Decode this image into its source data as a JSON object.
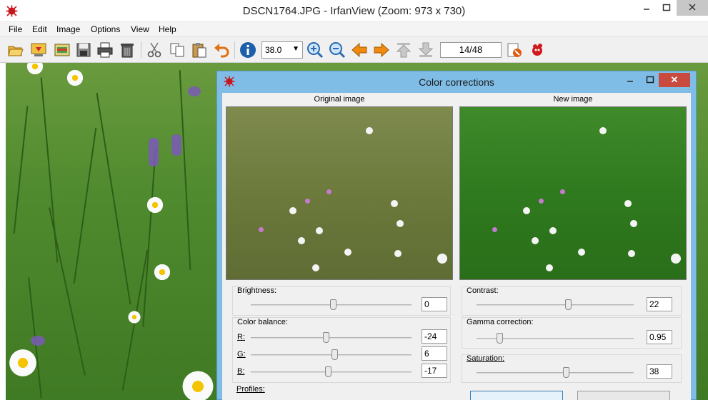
{
  "window": {
    "title": "DSCN1764.JPG - IrfanView (Zoom: 973 x 730)"
  },
  "menu": [
    "File",
    "Edit",
    "Image",
    "Options",
    "View",
    "Help"
  ],
  "toolbar": {
    "zoom_value": "38.0",
    "page_indicator": "14/48"
  },
  "dialog": {
    "title": "Color corrections",
    "original_label": "Original image",
    "new_label": "New image",
    "brightness": {
      "label": "Brightness:",
      "value": "0"
    },
    "color_balance": {
      "label": "Color balance:",
      "r_label": "R:",
      "r_value": "-24",
      "g_label": "G:",
      "g_value": "6",
      "b_label": "B:",
      "b_value": "-17"
    },
    "profiles_label": "Profiles:",
    "contrast": {
      "label": "Contrast:",
      "value": "22"
    },
    "gamma": {
      "label": "Gamma correction:",
      "value": "0.95"
    },
    "saturation": {
      "label": "Saturation:",
      "value": "38"
    }
  },
  "colors": {
    "dialog_frame": "#7fbde6",
    "close_button": "#c94a3e"
  }
}
